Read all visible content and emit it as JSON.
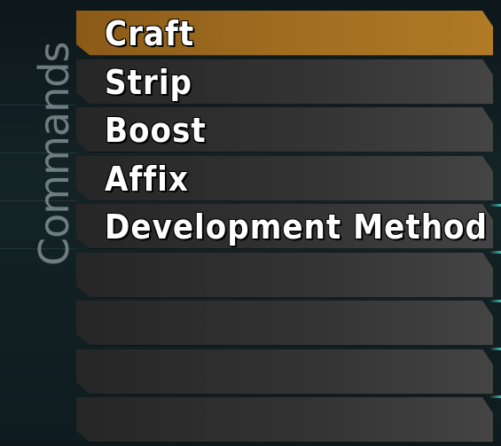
{
  "panel": {
    "title": "Commands"
  },
  "menu": {
    "items": [
      {
        "label": "Craft",
        "selected": true
      },
      {
        "label": "Strip",
        "selected": false
      },
      {
        "label": "Boost",
        "selected": false
      },
      {
        "label": "Affix",
        "selected": false
      },
      {
        "label": "Development Method",
        "selected": false
      },
      {
        "label": "",
        "selected": false
      },
      {
        "label": "",
        "selected": false
      },
      {
        "label": "",
        "selected": false
      },
      {
        "label": "",
        "selected": false
      }
    ]
  },
  "colors": {
    "selected_bg": "#a06d20",
    "item_bg": "#333333",
    "text": "#ffffff",
    "accent_glow": "#50dcd2"
  }
}
